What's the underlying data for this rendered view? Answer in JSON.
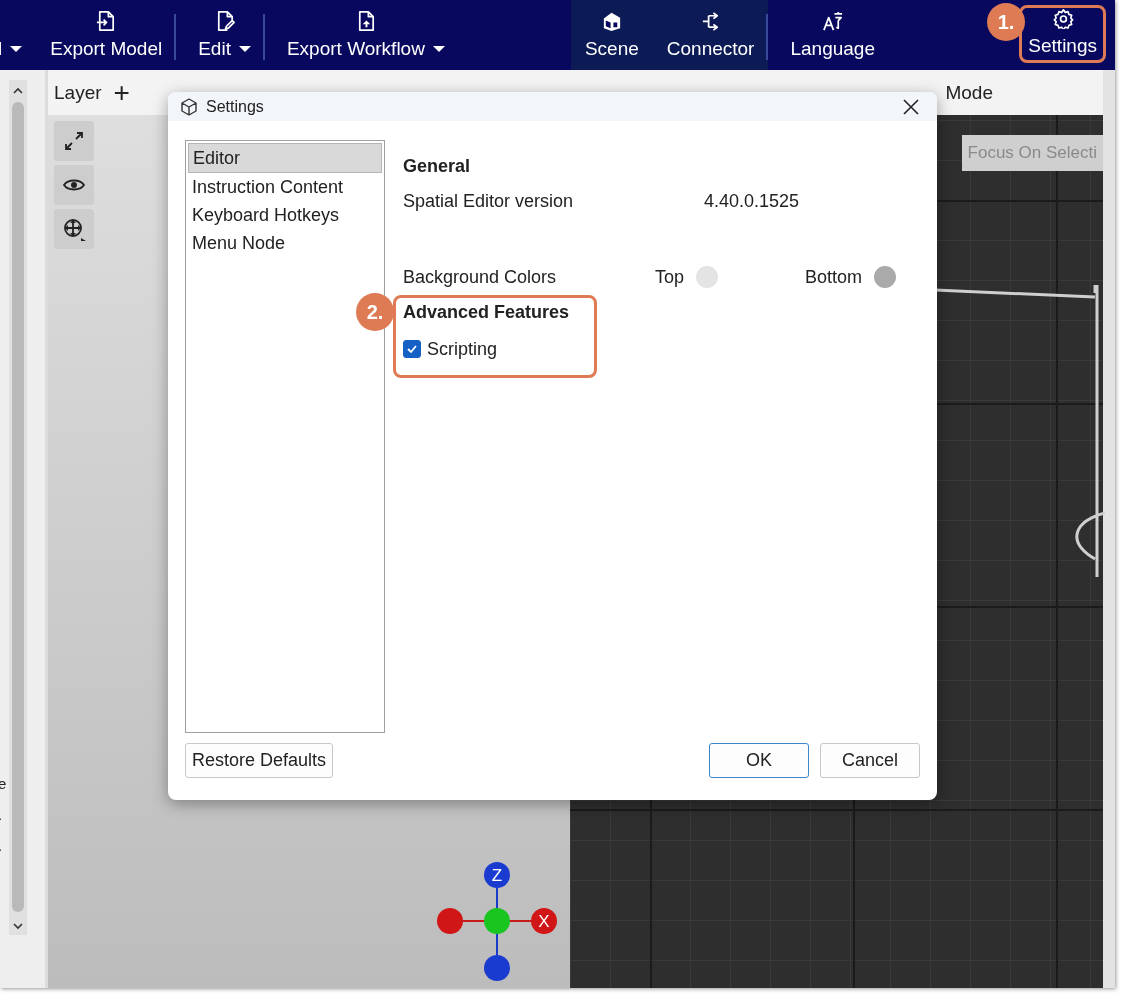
{
  "toolbar": {
    "items": [
      {
        "label": "l",
        "kind": "menu",
        "active": false,
        "separator_after": false
      },
      {
        "label": "Export Model",
        "kind": "button",
        "active": false,
        "separator_after": true
      },
      {
        "label": "Edit",
        "kind": "menu",
        "active": false,
        "separator_after": true
      },
      {
        "label": "Export Workflow",
        "kind": "menu",
        "active": false,
        "separator_after": false
      },
      {
        "label": "Scene",
        "kind": "button",
        "active": true,
        "separator_after": false
      },
      {
        "label": "Connector",
        "kind": "button",
        "active": true,
        "separator_after": true
      },
      {
        "label": "Language",
        "kind": "button",
        "active": false,
        "separator_after": false
      },
      {
        "label": "Settings",
        "kind": "button",
        "active": false,
        "separator_after": false
      }
    ]
  },
  "layer_bar": {
    "label": "Layer",
    "add": "+",
    "mode": "Mode"
  },
  "left_panel": {
    "fragments": [
      "e",
      ".",
      "."
    ]
  },
  "viewport": {
    "focus_button": "Focus On Selecti",
    "gizmo": {
      "z": "Z",
      "x": "X"
    }
  },
  "dialog": {
    "title": "Settings",
    "nav": [
      {
        "label": "Editor",
        "selected": true
      },
      {
        "label": "Instruction Content",
        "selected": false
      },
      {
        "label": "Keyboard Hotkeys",
        "selected": false
      },
      {
        "label": "Menu Node",
        "selected": false
      }
    ],
    "general": {
      "heading": "General",
      "rows": [
        {
          "label": "Spatial Editor version",
          "value": "4.40.0.1525"
        }
      ]
    },
    "background": {
      "label": "Background Colors",
      "swatches": [
        {
          "label": "Top",
          "color": "#e4e4e4"
        },
        {
          "label": "Bottom",
          "color": "#aaaaaa"
        }
      ]
    },
    "advanced": {
      "heading": "Advanced Features",
      "options": [
        {
          "label": "Scripting",
          "checked": true
        }
      ]
    },
    "buttons": [
      {
        "label": "Restore Defaults",
        "kind": "secondary"
      },
      {
        "label": "OK",
        "kind": "default"
      },
      {
        "label": "Cancel",
        "kind": "secondary"
      }
    ]
  },
  "annotations": [
    {
      "label": "1."
    },
    {
      "label": "2."
    }
  ]
}
